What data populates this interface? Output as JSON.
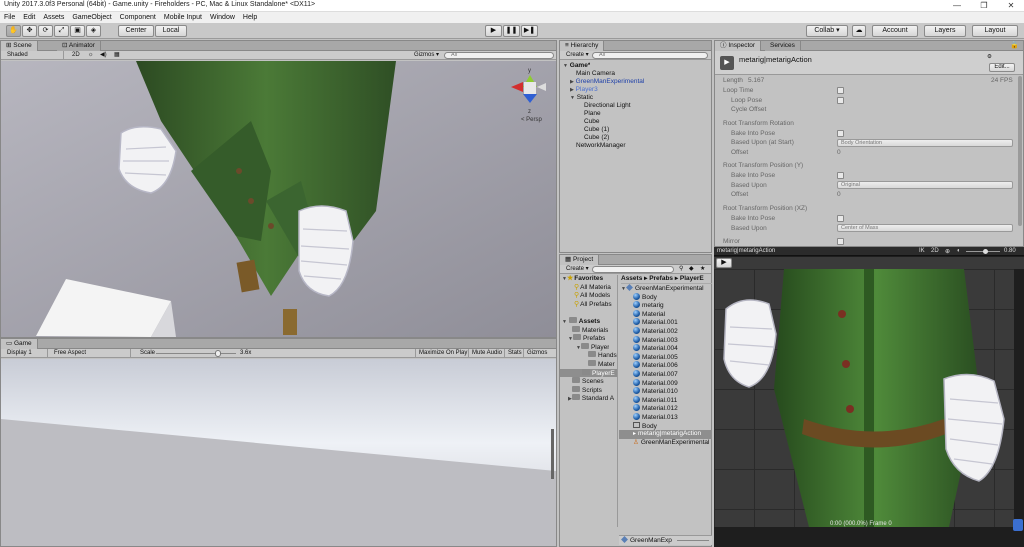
{
  "window": {
    "title": "Unity 2017.3.0f3 Personal (64bit) - Game.unity - Fireholders - PC, Mac & Linux Standalone* <DX11>",
    "min": "—",
    "max": "❐",
    "close": "✕"
  },
  "menu": [
    "File",
    "Edit",
    "Assets",
    "GameObject",
    "Component",
    "Mobile Input",
    "Window",
    "Help"
  ],
  "toolbar": {
    "center": "Center",
    "local": "Local",
    "collab": "Collab ▾",
    "account": "Account",
    "layers": "Layers",
    "layout": "Layout"
  },
  "scene": {
    "tab_scene": "Scene",
    "tab_animator": "Animator",
    "shading": "Shaded",
    "mode_2d": "2D",
    "gizmos": "Gizmos ▾",
    "search": "All",
    "persp": "< Persp",
    "axis_y": "y",
    "axis_z": "z"
  },
  "game": {
    "tab": "Game",
    "display": "Display 1",
    "aspect": "Free Aspect",
    "scale_label": "Scale",
    "scale_value": "3.6x",
    "max_on_play": "Maximize On Play",
    "mute": "Mute Audio",
    "stats": "Stats",
    "gizmos": "Gizmos"
  },
  "hierarchy": {
    "tab": "Hierarchy",
    "create": "Create ▾",
    "search": "All",
    "root": "Game*",
    "items": [
      {
        "label": "Main Camera",
        "blue": false,
        "indent": 1,
        "arrow": ""
      },
      {
        "label": "GreenManExperimental",
        "blue": true,
        "indent": 1,
        "arrow": "▶"
      },
      {
        "label": "Player3",
        "blue": true,
        "indent": 1,
        "arrow": "▶"
      },
      {
        "label": "Static",
        "blue": false,
        "indent": 1,
        "arrow": "▼"
      },
      {
        "label": "Directional Light",
        "blue": false,
        "indent": 2,
        "arrow": ""
      },
      {
        "label": "Plane",
        "blue": false,
        "indent": 2,
        "arrow": ""
      },
      {
        "label": "Cube",
        "blue": false,
        "indent": 2,
        "arrow": ""
      },
      {
        "label": "Cube (1)",
        "blue": false,
        "indent": 2,
        "arrow": ""
      },
      {
        "label": "Cube (2)",
        "blue": false,
        "indent": 2,
        "arrow": ""
      },
      {
        "label": "NetworkManager",
        "blue": false,
        "indent": 1,
        "arrow": ""
      }
    ]
  },
  "project": {
    "tab": "Project",
    "create": "Create ▾",
    "breadcrumb": "Assets ▸ Prefabs ▸ PlayerE",
    "favorites": "Favorites",
    "fav_items": [
      "All Materia",
      "All Models",
      "All Prefabs"
    ],
    "assets": "Assets",
    "folders": [
      {
        "label": "Materials",
        "indent": 1
      },
      {
        "label": "Prefabs",
        "indent": 1
      },
      {
        "label": "Player",
        "indent": 2
      },
      {
        "label": "Hands",
        "indent": 3
      },
      {
        "label": "Mater",
        "indent": 3
      },
      {
        "label": "PlayerE",
        "indent": 2
      },
      {
        "label": "Scenes",
        "indent": 1
      },
      {
        "label": "Scripts",
        "indent": 1
      },
      {
        "label": "Standard A",
        "indent": 1
      }
    ],
    "files": [
      {
        "label": "GreenManExperimental",
        "kind": "prefab",
        "indent": 0
      },
      {
        "label": "Body",
        "kind": "sphere",
        "indent": 1
      },
      {
        "label": "metarig",
        "kind": "sphere",
        "indent": 1
      },
      {
        "label": "Material",
        "kind": "sphere",
        "indent": 1
      },
      {
        "label": "Material.001",
        "kind": "sphere",
        "indent": 1
      },
      {
        "label": "Material.002",
        "kind": "sphere",
        "indent": 1
      },
      {
        "label": "Material.003",
        "kind": "sphere",
        "indent": 1
      },
      {
        "label": "Material.004",
        "kind": "sphere",
        "indent": 1
      },
      {
        "label": "Material.005",
        "kind": "sphere",
        "indent": 1
      },
      {
        "label": "Material.006",
        "kind": "sphere",
        "indent": 1
      },
      {
        "label": "Material.007",
        "kind": "sphere",
        "indent": 1
      },
      {
        "label": "Material.009",
        "kind": "sphere",
        "indent": 1
      },
      {
        "label": "Material.010",
        "kind": "sphere",
        "indent": 1
      },
      {
        "label": "Material.011",
        "kind": "sphere",
        "indent": 1
      },
      {
        "label": "Material.012",
        "kind": "sphere",
        "indent": 1
      },
      {
        "label": "Material.013",
        "kind": "sphere",
        "indent": 1
      },
      {
        "label": "Body",
        "kind": "mesh",
        "indent": 1
      },
      {
        "label": "metarig|metarigAction",
        "kind": "anim",
        "indent": 1
      },
      {
        "label": "GreenManExperimental",
        "kind": "avatar",
        "indent": 1
      }
    ],
    "footer": "GreenManExp"
  },
  "inspector": {
    "tab_inspector": "Inspector",
    "tab_services": "Services",
    "object_name": "metarig|metarigAction",
    "edit": "Edit...",
    "length_label": "Length",
    "length_value": "5.167",
    "fps": "24 FPS",
    "loop_time": "Loop Time",
    "loop_pose": "Loop Pose",
    "cycle_offset": "Cycle Offset",
    "rrot": "Root Transform Rotation",
    "bake1": "Bake Into Pose",
    "based1": "Based Upon (at Start)",
    "based1_val": "Body Orientation",
    "offset1": "Offset",
    "offset1_val": "0",
    "rposy": "Root Transform Position (Y)",
    "bake2": "Bake Into Pose",
    "based2": "Based Upon",
    "based2_val": "Original",
    "offset2": "Offset",
    "offset2_val": "0",
    "rposxz": "Root Transform Position (XZ)",
    "bake3": "Bake Into Pose",
    "based3": "Based Upon",
    "based3_val": "Center of Mass",
    "mirror": "Mirror"
  },
  "preview": {
    "title": "metarig|metarigAction",
    "ik": "IK",
    "mode_2d": "2D",
    "speed": "0.80",
    "play": "▶",
    "status": "0:00 (000.0%) Frame 0"
  }
}
